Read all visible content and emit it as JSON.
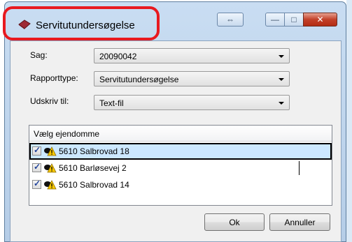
{
  "window": {
    "title": "Servitutundersøgelse",
    "caption_buttons": {
      "swap": "⇔",
      "minimize": "—",
      "maximize": "□",
      "close": "✕"
    }
  },
  "form": {
    "case_label": "Sag:",
    "case_value": "20090042",
    "report_type_label": "Rapporttype:",
    "report_type_value": "Servitutundersøgelse",
    "print_to_label": "Udskriv til:",
    "print_to_value": "Text-fil"
  },
  "property_list": {
    "header": "Vælg ejendomme",
    "items": [
      {
        "label": "5610 Salbrovad 18",
        "checked": true,
        "selected": true
      },
      {
        "label": "5610 Barløsevej 2",
        "checked": true,
        "selected": false
      },
      {
        "label": "5610 Salbrovad 14",
        "checked": true,
        "selected": false
      }
    ],
    "check_mark": "✓"
  },
  "buttons": {
    "ok": "Ok",
    "cancel": "Annuller"
  },
  "colors": {
    "highlight": "#e8191f",
    "selected_row": "#cce8ff",
    "close_button": "#c3412a",
    "frame": "#b5cde7"
  }
}
